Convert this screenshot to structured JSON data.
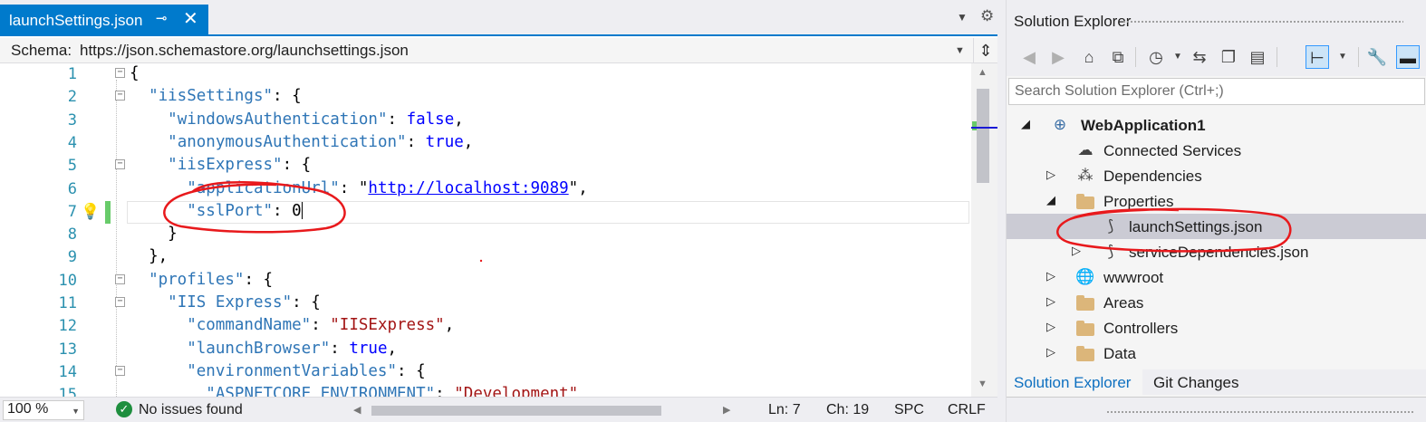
{
  "editor": {
    "tab_title": "launchSettings.json",
    "pin_icon": "⊸",
    "close_icon": "✕",
    "schema_label": "Schema:",
    "schema_value": "https://json.schemastore.org/launchsettings.json",
    "lines": [
      {
        "n": "1"
      },
      {
        "n": "2"
      },
      {
        "n": "3"
      },
      {
        "n": "4"
      },
      {
        "n": "5"
      },
      {
        "n": "6"
      },
      {
        "n": "7"
      },
      {
        "n": "8"
      },
      {
        "n": "9"
      },
      {
        "n": "10"
      },
      {
        "n": "11"
      },
      {
        "n": "12"
      },
      {
        "n": "13"
      },
      {
        "n": "14"
      },
      {
        "n": "15"
      }
    ],
    "tokens": {
      "l2k": "\"iisSettings\"",
      "l3k": "\"windowsAuthentication\"",
      "l3v": "false",
      "l4k": "\"anonymousAuthentication\"",
      "l4v": "true",
      "l5k": "\"iisExpress\"",
      "l6k": "\"applicationUrl\"",
      "l6v": "http://localhost:9089",
      "l7k": "\"sslPort\"",
      "l7v": "0",
      "l10k": "\"profiles\"",
      "l11k": "\"IIS Express\"",
      "l12k": "\"commandName\"",
      "l12v": "\"IISExpress\"",
      "l13k": "\"launchBrowser\"",
      "l13v": "true",
      "l14k": "\"environmentVariables\"",
      "l15k": "\"ASPNETCORE_ENVIRONMENT\"",
      "l15v": "\"Development\""
    }
  },
  "status": {
    "zoom": "100 %",
    "issues": "No issues found",
    "ln": "Ln: 7",
    "ch": "Ch: 19",
    "spc": "SPC",
    "crlf": "CRLF"
  },
  "solution_explorer": {
    "title": "Solution Explorer",
    "search_placeholder": "Search Solution Explorer (Ctrl+;)",
    "tree": [
      {
        "label": "WebApplication1",
        "icon": "web-project-icon"
      },
      {
        "label": "Connected Services",
        "icon": "connected-services-icon"
      },
      {
        "label": "Dependencies",
        "icon": "dependencies-icon"
      },
      {
        "label": "Properties",
        "icon": "folder-icon"
      },
      {
        "label": "launchSettings.json",
        "icon": "json-file-icon"
      },
      {
        "label": "serviceDependencies.json",
        "icon": "json-file-icon"
      },
      {
        "label": "wwwroot",
        "icon": "globe-icon"
      },
      {
        "label": "Areas",
        "icon": "folder-icon"
      },
      {
        "label": "Controllers",
        "icon": "folder-icon"
      },
      {
        "label": "Data",
        "icon": "folder-icon"
      }
    ],
    "tabs": [
      "Solution Explorer",
      "Git Changes"
    ]
  },
  "colors": {
    "accent": "#007acc",
    "annotation": "#e8191c",
    "json_key": "#2e75b6",
    "json_string": "#a31515",
    "json_keyword": "#0000ff"
  }
}
